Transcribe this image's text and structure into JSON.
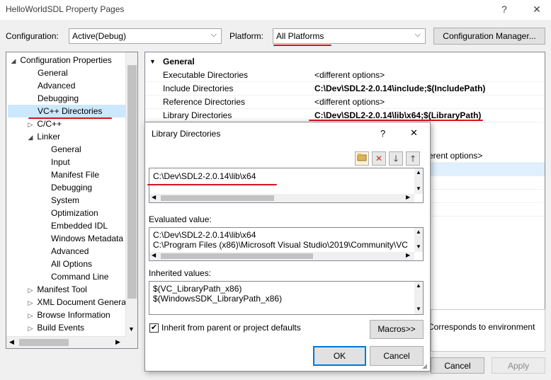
{
  "window": {
    "title": "HelloWorldSDL Property Pages",
    "help_glyph": "?",
    "close_glyph": "✕"
  },
  "toolbar": {
    "configuration_label": "Configuration:",
    "configuration_value": "Active(Debug)",
    "platform_label": "Platform:",
    "platform_value": "All Platforms",
    "config_manager_label": "Configuration Manager..."
  },
  "tree": {
    "root": "Configuration Properties",
    "items": [
      {
        "label": "General"
      },
      {
        "label": "Advanced"
      },
      {
        "label": "Debugging"
      },
      {
        "label": "VC++ Directories"
      },
      {
        "label": "C/C++"
      },
      {
        "label": "Linker"
      },
      {
        "label": "General"
      },
      {
        "label": "Input"
      },
      {
        "label": "Manifest File"
      },
      {
        "label": "Debugging"
      },
      {
        "label": "System"
      },
      {
        "label": "Optimization"
      },
      {
        "label": "Embedded IDL"
      },
      {
        "label": "Windows Metadata"
      },
      {
        "label": "Advanced"
      },
      {
        "label": "All Options"
      },
      {
        "label": "Command Line"
      },
      {
        "label": "Manifest Tool"
      },
      {
        "label": "XML Document Genera"
      },
      {
        "label": "Browse Information"
      },
      {
        "label": "Build Events"
      }
    ]
  },
  "grid": {
    "section": "General",
    "rows": [
      {
        "key": "Executable Directories",
        "value": "<different options>"
      },
      {
        "key": "Include Directories",
        "value": "C:\\Dev\\SDL2-2.0.14\\include;$(IncludePath)"
      },
      {
        "key": "Reference Directories",
        "value": "<different options>"
      },
      {
        "key": "Library Directories",
        "value": "C:\\Dev\\SDL2-2.0.14\\lib\\x64;$(LibraryPath)"
      }
    ],
    "partial_value": "erent options>",
    "description": "Corresponds to environment"
  },
  "buttons": {
    "cancel": "Cancel",
    "apply": "Apply"
  },
  "dialog": {
    "title": "Library Directories",
    "help_glyph": "?",
    "close_glyph": "✕",
    "entry": "C:\\Dev\\SDL2-2.0.14\\lib\\x64",
    "evaluated_label": "Evaluated value:",
    "evaluated_lines": [
      "C:\\Dev\\SDL2-2.0.14\\lib\\x64",
      "C:\\Program Files (x86)\\Microsoft Visual Studio\\2019\\Community\\VC"
    ],
    "inherited_label": "Inherited values:",
    "inherited_lines": [
      "$(VC_LibraryPath_x86)",
      "$(WindowsSDK_LibraryPath_x86)"
    ],
    "inherit_checkbox_label": "Inherit from parent or project defaults",
    "inherit_checked": true,
    "macros_label": "Macros>>",
    "ok_label": "OK",
    "cancel_label": "Cancel"
  },
  "colors": {
    "highlight_underline": "#d8131b",
    "selection": "#cce8ff"
  }
}
